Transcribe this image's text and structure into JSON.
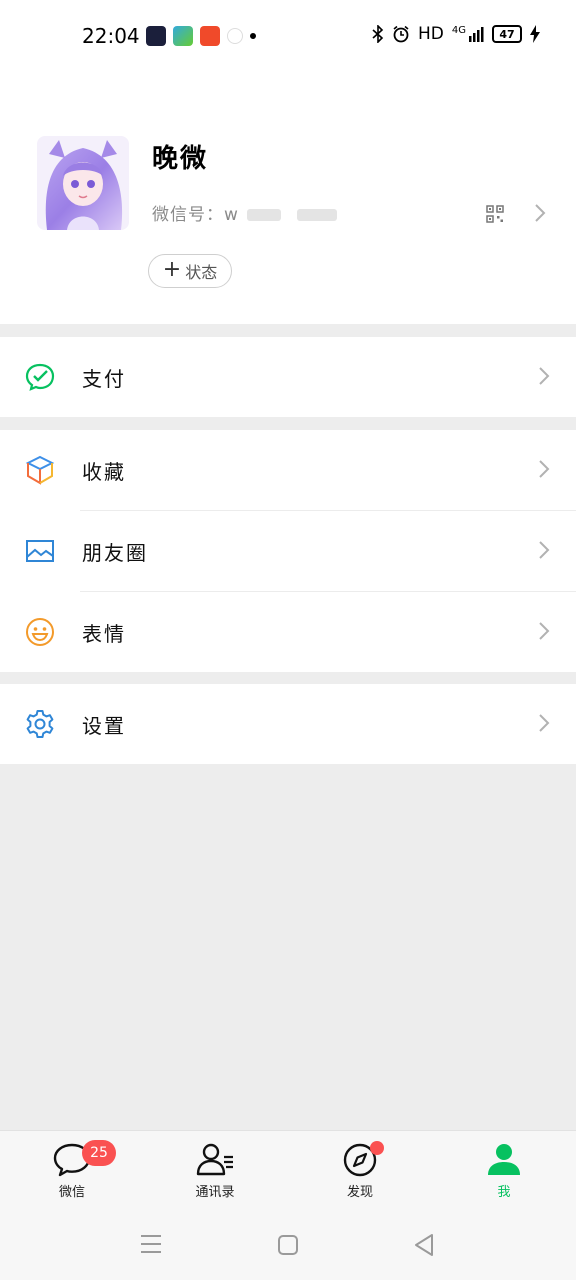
{
  "status_bar": {
    "time": "22:04",
    "network": "HD",
    "signal": "4G",
    "battery": "47",
    "icons": [
      "bluetooth-icon",
      "alarm-icon",
      "signal-icon",
      "charging-icon"
    ]
  },
  "profile": {
    "nickname": "晚微",
    "wechat_id_label": "微信号：",
    "wechat_id_value": "w",
    "status_button_label": "状态"
  },
  "menu": {
    "pay": "支付",
    "favorites": "收藏",
    "moments": "朋友圈",
    "stickers": "表情",
    "settings": "设置"
  },
  "bottom_nav": {
    "chats": "微信",
    "chats_badge": "25",
    "contacts": "通讯录",
    "discover": "发现",
    "me": "我"
  },
  "colors": {
    "accent_green": "#07c160",
    "badge_red": "#fa5151",
    "background": "#ededed"
  }
}
